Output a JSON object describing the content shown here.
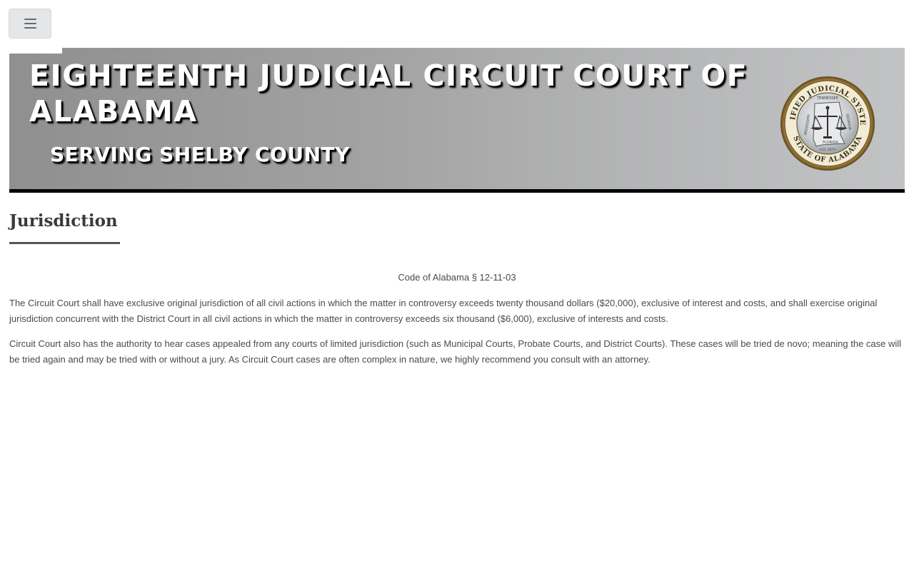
{
  "nav": {
    "menu_icon": "hamburger-menu-icon"
  },
  "banner": {
    "title": "EIGHTEENTH JUDICIAL CIRCUIT COURT OF ALABAMA",
    "subtitle": "SERVING SHELBY COUNTY",
    "seal": {
      "top_text": "UNIFIED JUDICIAL SYSTEM",
      "bottom_text": "STATE OF ALABAMA",
      "left_text": "MISSISSIPPI",
      "north_text": "TENNESSEE",
      "right_text": "GEORGIA",
      "south_text": "FLORIDA",
      "date_text": "A.D. 1973"
    }
  },
  "page": {
    "heading": "Jurisdiction",
    "citation": "Code of Alabama § 12-11-03",
    "paragraphs": [
      "The Circuit Court shall have exclusive original jurisdiction of all civil actions in which the matter in controversy exceeds twenty thousand dollars ($20,000), exclusive of interest and costs, and shall exercise original jurisdiction concurrent with the District Court in all civil actions in which the matter in controversy exceeds six thousand ($6,000), exclusive of interests and costs.",
      "Circuit Court also has the authority to hear cases appealed from any courts of limited jurisdiction (such as Municipal Courts, Probate Courts, and District Courts). These cases will be tried de novo; meaning the case will be tried again and may be tried with or without a jury. As Circuit Court cases are often complex in nature, we highly recommend you consult with an attorney."
    ]
  },
  "colors": {
    "banner_dark": "#8f8f8f",
    "banner_light": "#c2c3c4",
    "rule": "#555555",
    "text": "#4a4a4a"
  }
}
